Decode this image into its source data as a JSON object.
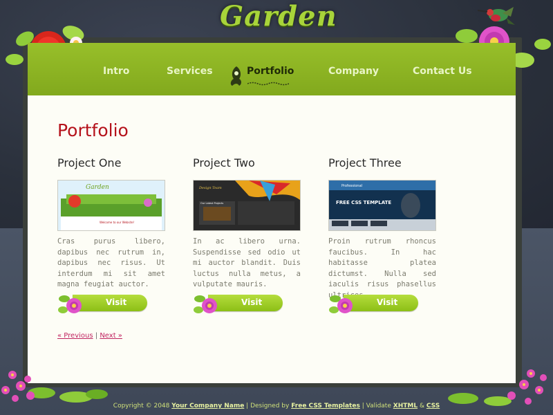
{
  "site": {
    "logo_text": "Garden"
  },
  "nav": {
    "items": [
      {
        "label": "Intro"
      },
      {
        "label": "Services"
      },
      {
        "label": "Portfolio",
        "active": true
      },
      {
        "label": "Company"
      },
      {
        "label": "Contact Us"
      }
    ]
  },
  "page": {
    "title": "Portfolio"
  },
  "projects": [
    {
      "title": "Project One",
      "description": "Cras purus libero, dapibus nec rutrum in, dapibus nec risus. Ut interdum mi sit amet magna feugiat auctor.",
      "visit_label": "Visit",
      "thumb": {
        "logo": "Garden",
        "caption": "Welcome to our Website!"
      }
    },
    {
      "title": "Project Two",
      "description": "In ac libero urna. Suspendisse sed odio ut mi auctor blandit. Duis luctus nulla metus, a vulputate mauris.",
      "visit_label": "Visit",
      "thumb": {
        "logo": "Design Team",
        "caption": "Our Latest Projects"
      }
    },
    {
      "title": "Project Three",
      "description": "Proin rutrum rhoncus faucibus. In hac habitasse platea dictumst. Nulla sed iaculis risus phasellus ultrices",
      "visit_label": "Visit",
      "thumb": {
        "logo": "Professional",
        "caption": "FREE CSS TEMPLATE"
      }
    }
  ],
  "pager": {
    "prev": "« Previous",
    "separator": "|",
    "next": "Next »"
  },
  "footer": {
    "copyright": "Copyright © 2048",
    "company_link": "Your Company Name",
    "sep1": "|",
    "designed_by": "Designed by",
    "designer_link": "Free CSS Templates",
    "sep2": "|",
    "validate": "Validate",
    "xhtml_link": "XHTML",
    "amp": "&",
    "css_link": "CSS"
  },
  "colors": {
    "nav_green": "#8fb525",
    "title_red": "#b5121b",
    "content_bg": "#fdfdf6",
    "link_pink": "#c02460"
  }
}
